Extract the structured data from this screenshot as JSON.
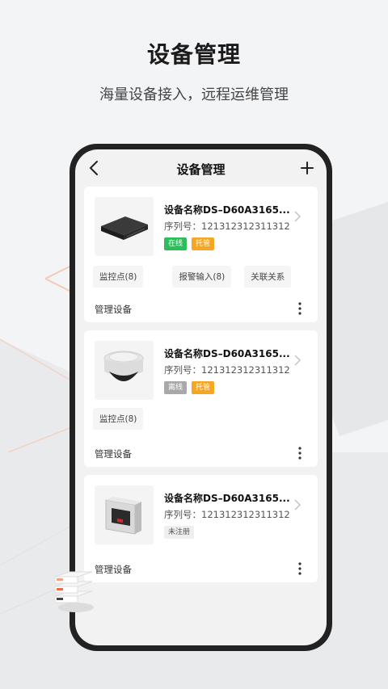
{
  "header": {
    "title": "设备管理",
    "subtitle": "海量设备接入，远程运维管理"
  },
  "navbar": {
    "title": "设备管理",
    "back_icon": "chevron-left-icon",
    "add_icon": "plus-icon"
  },
  "devices": [
    {
      "name": "设备名称DS–D60A3165...",
      "serial": "序列号：121312312311312",
      "image": "nvr-recorder",
      "status": {
        "label": "在线",
        "color": "#2dbd5a"
      },
      "hosting": {
        "label": "托管",
        "color": "#f5a623"
      },
      "chips": [
        "监控点(8)",
        "报警输入(8)",
        "关联关系"
      ],
      "manage_label": "管理设备"
    },
    {
      "name": "设备名称DS–D60A3165...",
      "serial": "序列号：121312312311312",
      "image": "dome-camera",
      "status": {
        "label": "离线",
        "color": "#a9a9a9"
      },
      "hosting": {
        "label": "托管",
        "color": "#f5a623"
      },
      "chips": [
        "监控点(8)"
      ],
      "manage_label": "管理设备"
    },
    {
      "name": "设备名称DS–D60A3165...",
      "serial": "序列号：121312312311312",
      "image": "access-control-panel",
      "status": {
        "label": "未注册",
        "color": "#efefef"
      },
      "manage_label": "管理设备"
    }
  ]
}
